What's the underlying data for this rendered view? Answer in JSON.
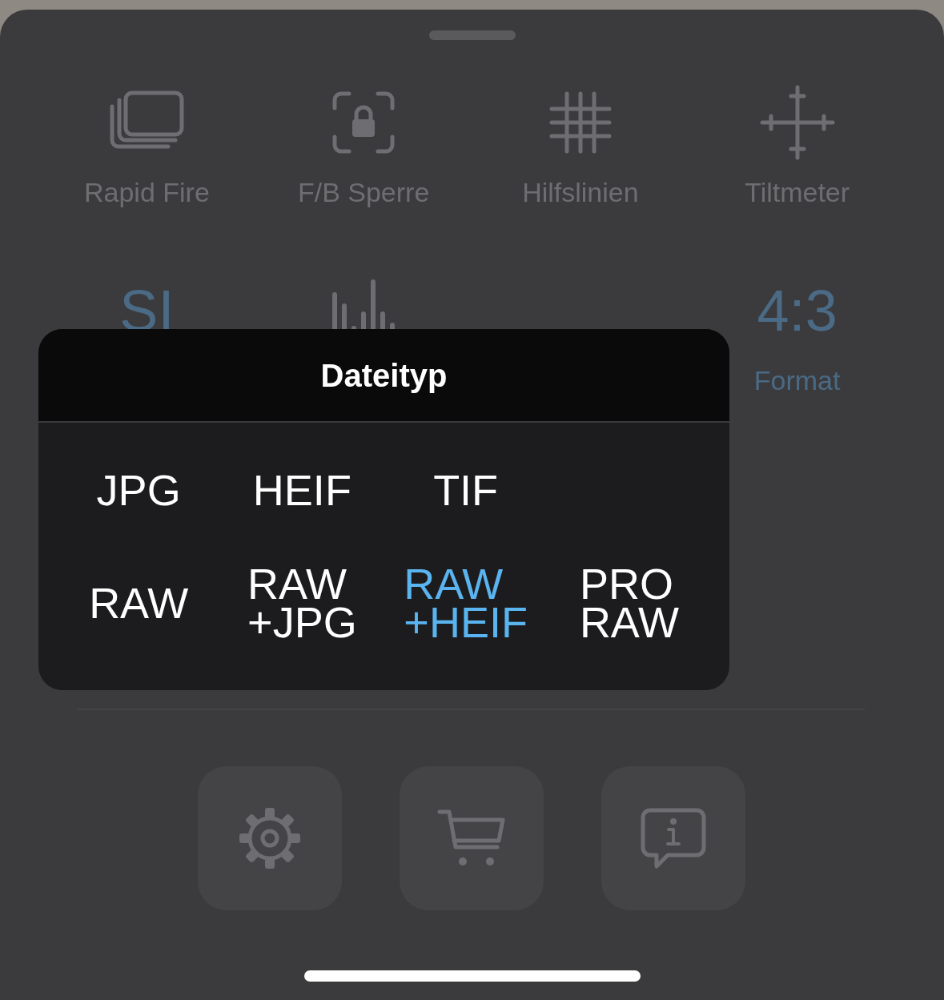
{
  "sheet": {
    "tiles": [
      {
        "kind": "icon",
        "label": "Rapid Fire"
      },
      {
        "kind": "icon",
        "label": "F/B Sperre"
      },
      {
        "kind": "icon",
        "label": "Hilfslinien"
      },
      {
        "kind": "icon",
        "label": "Tiltmeter"
      },
      {
        "kind": "value",
        "value": "SI"
      },
      {
        "kind": "icon"
      },
      {
        "kind": "empty"
      },
      {
        "kind": "value",
        "value": "4:3",
        "label": "Format"
      }
    ]
  },
  "popup": {
    "title": "Dateityp",
    "options": [
      {
        "label": "JPG",
        "selected": false
      },
      {
        "label": "HEIF",
        "selected": false
      },
      {
        "label": "TIF",
        "selected": false
      },
      {
        "label": "RAW",
        "selected": false
      },
      {
        "label": "RAW\n+JPG",
        "selected": false
      },
      {
        "label": "RAW\n+HEIF",
        "selected": true
      },
      {
        "label": "PRO\nRAW",
        "selected": false
      }
    ]
  }
}
